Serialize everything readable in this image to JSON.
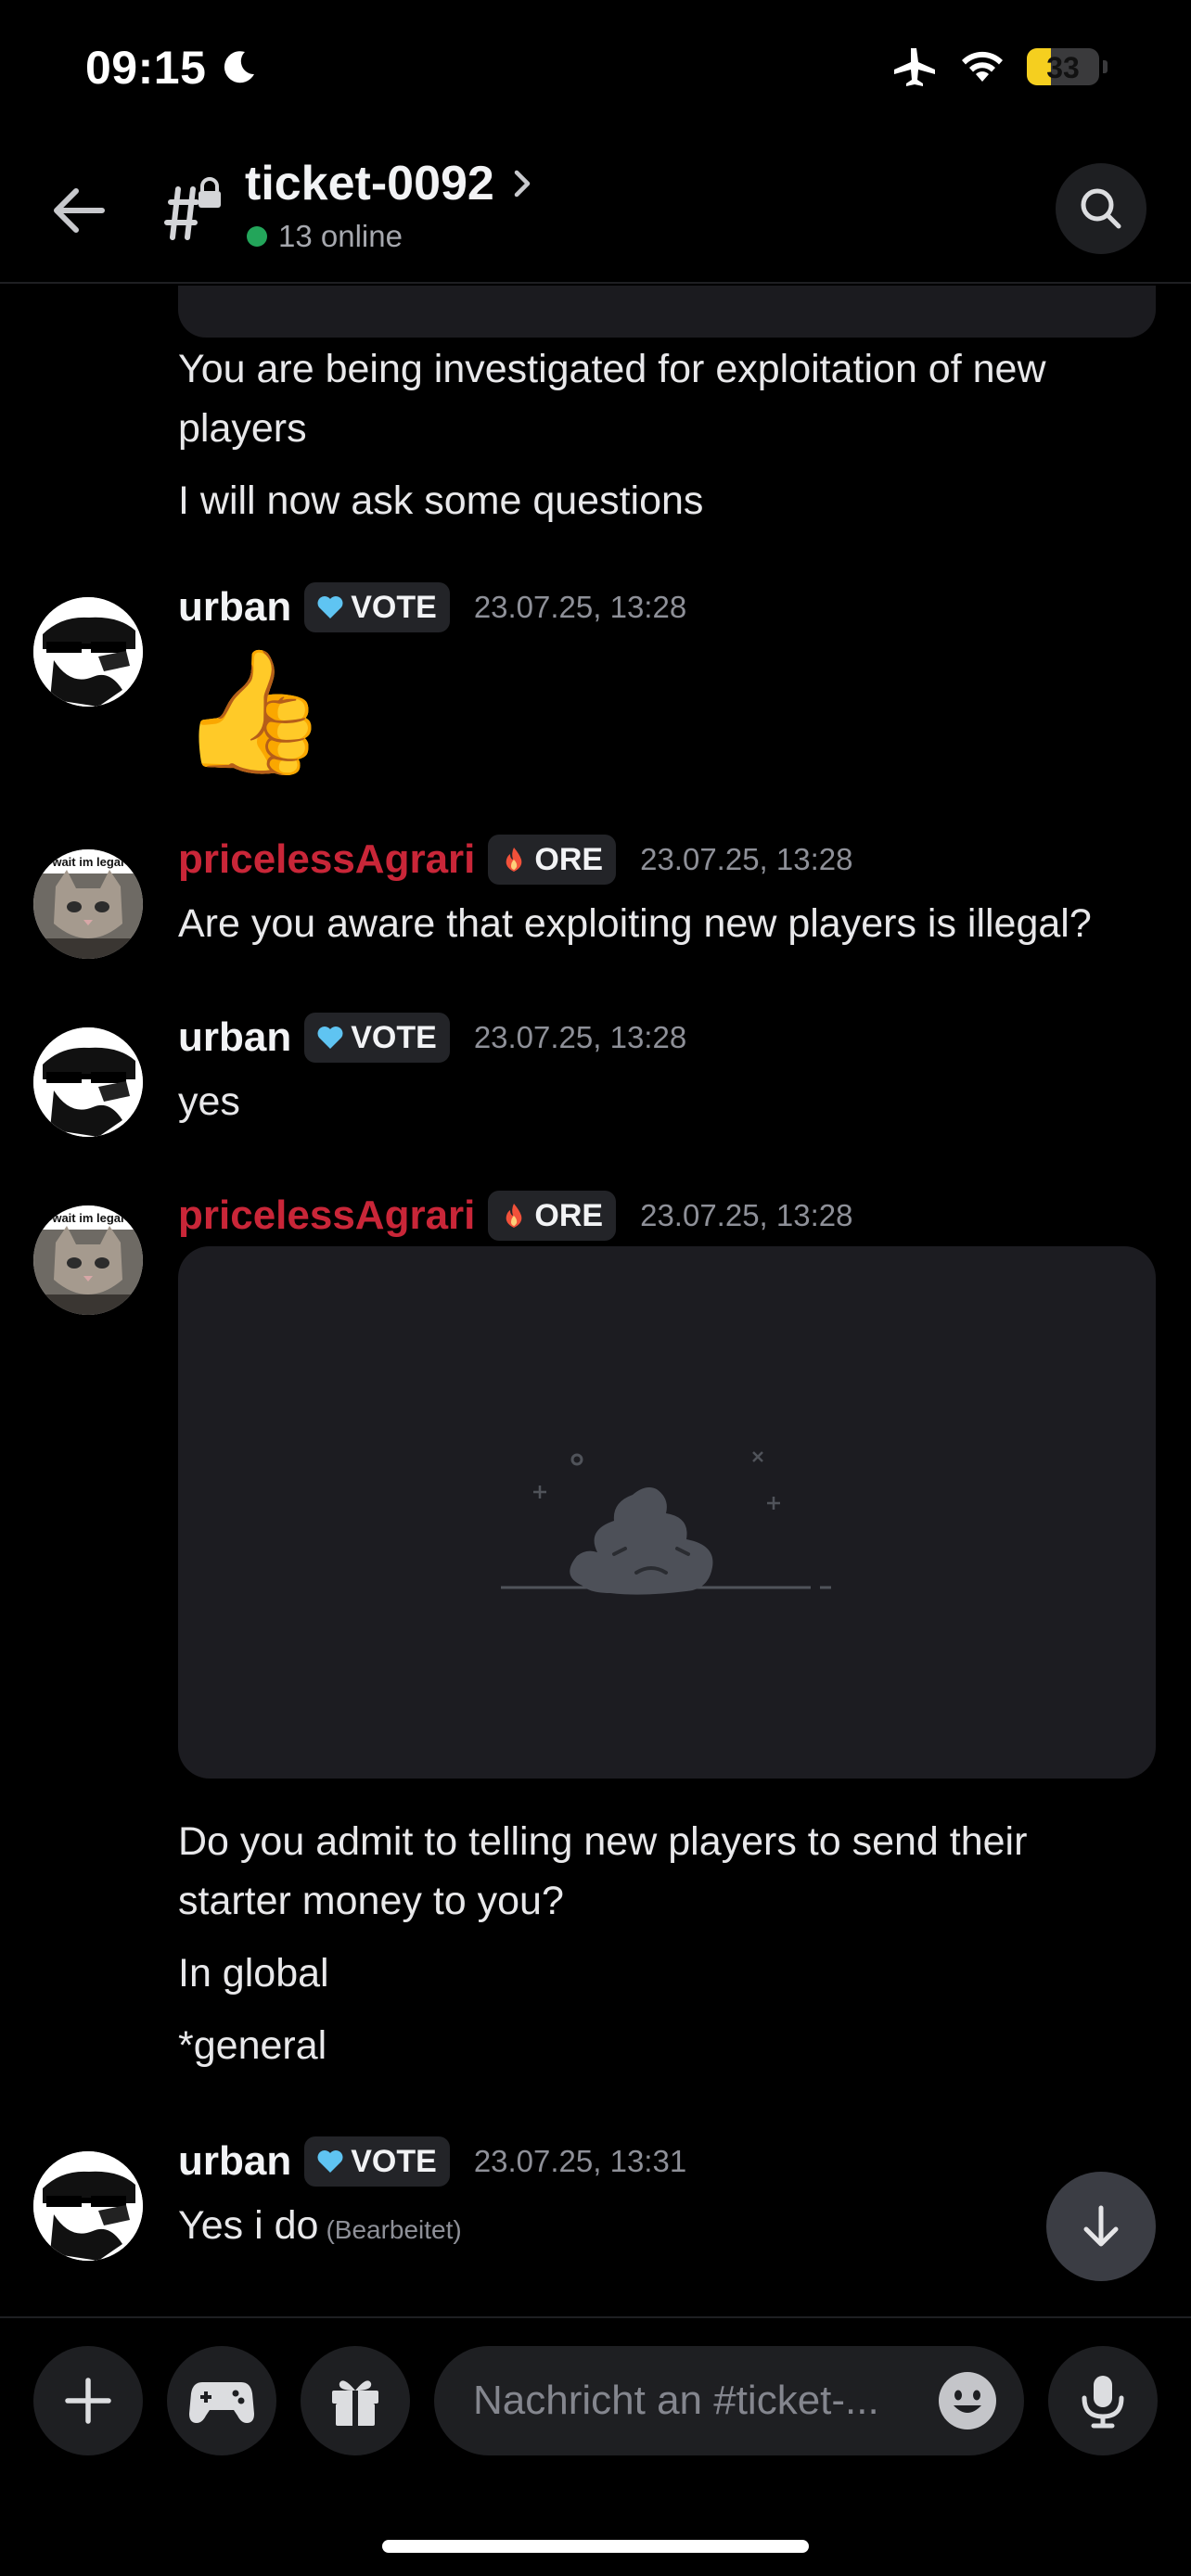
{
  "status_bar": {
    "time": "09:15",
    "battery": "33",
    "battery_level": 0.33,
    "icons": [
      "moon-icon",
      "airplane-icon",
      "wifi-icon",
      "battery-icon"
    ]
  },
  "header": {
    "channel_name": "ticket-0092",
    "online": "13 online"
  },
  "messages": {
    "prev_text_1a": "You are being investigated for exploitation of new",
    "prev_text_1b": "players",
    "prev_text_2": "I will now ask some questions",
    "m1": {
      "author": "urban",
      "role": "VOTE",
      "time": "23.07.25, 13:28",
      "content": "👍"
    },
    "m2": {
      "author": "pricelessAgrari",
      "role": "ORE",
      "time": "23.07.25, 13:28",
      "content": "Are you aware that exploiting new players is illegal?"
    },
    "m3": {
      "author": "urban",
      "role": "VOTE",
      "time": "23.07.25, 13:28",
      "content": "yes"
    },
    "m4": {
      "author": "pricelessAgrari",
      "role": "ORE",
      "time": "23.07.25, 13:28",
      "line1a": "Do you admit to telling new players to send their",
      "line1b": "starter money to you?",
      "line2": "In global",
      "line3": "*general"
    },
    "m5": {
      "author": "urban",
      "role": "VOTE",
      "time": "23.07.25, 13:31",
      "content": "Yes i do",
      "edited": "(Bearbeitet)"
    },
    "avatar_caption": "wait im legal"
  },
  "composer": {
    "placeholder": "Nachricht an #ticket-..."
  },
  "colors": {
    "background": "#000000",
    "online": "#23a55a",
    "priceless_name": "#c92638",
    "battery": "#f5cf1f"
  }
}
